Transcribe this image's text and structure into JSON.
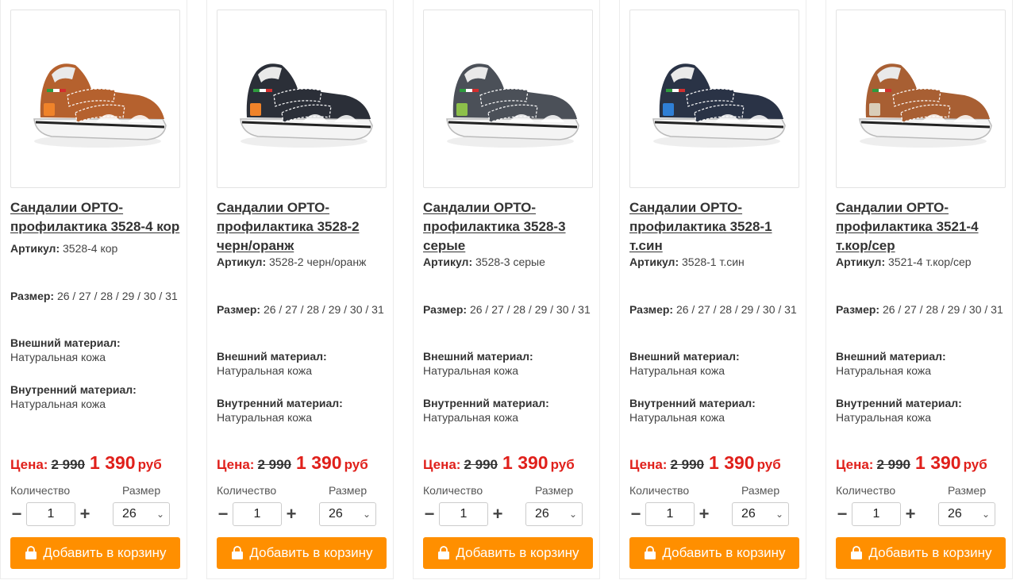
{
  "labels": {
    "article": "Артикул:",
    "size": "Размер:",
    "outer": "Внешний материал:",
    "inner": "Внутренний материал:",
    "price": "Цена:",
    "qty": "Количество",
    "size_select": "Размер",
    "add": "Добавить в корзину",
    "minus": "−",
    "plus": "+"
  },
  "colors": {
    "accent": "#ff8f00",
    "price_red": "#e0201b"
  },
  "products": [
    {
      "title": "Сандалии ОРТО-профилактика 3528-4 кор",
      "article": "3528-4 кор",
      "sizes": "26 / 27 / 28 / 29 / 30 / 31",
      "outer": "Натуральная кожа",
      "inner": "Натуральная кожа",
      "old_price": "2 990",
      "new_price": "1 390",
      "currency": "руб",
      "qty": "1",
      "size": "26",
      "color_upper": "#b5612e",
      "color_accent": "#f0832a",
      "image_alt": "brown-orange-sandal-icon"
    },
    {
      "title": "Сандалии ОРТО-профилактика 3528-2 черн/оранж",
      "article": "3528-2 черн/оранж",
      "sizes": "26 / 27 / 28 / 29 / 30 / 31",
      "outer": "Натуральная кожа",
      "inner": "Натуральная кожа",
      "old_price": "2 990",
      "new_price": "1 390",
      "currency": "руб",
      "qty": "1",
      "size": "26",
      "color_upper": "#2b2f38",
      "color_accent": "#f0832a",
      "image_alt": "black-orange-sandal-icon"
    },
    {
      "title": "Сандалии ОРТО-профилактика 3528-3 серые",
      "article": "3528-3 серые",
      "sizes": "26 / 27 / 28 / 29 / 30 / 31",
      "outer": "Натуральная кожа",
      "inner": "Натуральная кожа",
      "old_price": "2 990",
      "new_price": "1 390",
      "currency": "руб",
      "qty": "1",
      "size": "26",
      "color_upper": "#4b5058",
      "color_accent": "#8dc04a",
      "image_alt": "grey-sandal-icon"
    },
    {
      "title": "Сандалии ОРТО-профилактика 3528-1 т.син",
      "article": "3528-1 т.син",
      "sizes": "26 / 27 / 28 / 29 / 30 / 31",
      "outer": "Натуральная кожа",
      "inner": "Натуральная кожа",
      "old_price": "2 990",
      "new_price": "1 390",
      "currency": "руб",
      "qty": "1",
      "size": "26",
      "color_upper": "#2a3346",
      "color_accent": "#2f7fd6",
      "image_alt": "navy-sandal-icon"
    },
    {
      "title": "Сандалии ОРТО-профилактика 3521-4 т.кор/сер",
      "article": "3521-4 т.кор/сер",
      "sizes": "26 / 27 / 28 / 29 / 30 / 31",
      "outer": "Натуральная кожа",
      "inner": "Натуральная кожа",
      "old_price": "2 990",
      "new_price": "1 390",
      "currency": "руб",
      "qty": "1",
      "size": "26",
      "color_upper": "#a85f33",
      "color_accent": "#d9cdb8",
      "image_alt": "brown-grey-sandal-icon"
    }
  ]
}
